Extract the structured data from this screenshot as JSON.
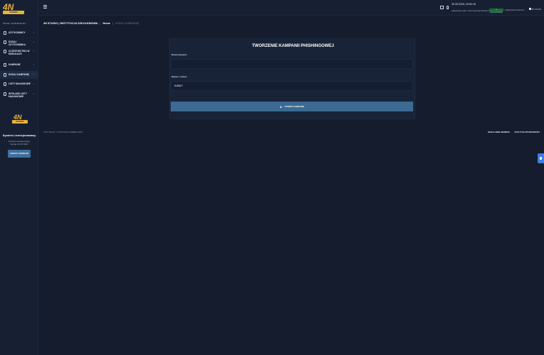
{
  "app": {
    "logo_mark": "4N",
    "logo_sub": "STUDIO"
  },
  "sidebar": {
    "panel_label": "PANEL KONTROLNY",
    "items": [
      {
        "label": "UŻYTKOWNICY"
      },
      {
        "label": "DODAJ UŻYTKOWNIKA"
      },
      {
        "label": "UCZESTNICTWO W MODUŁACH"
      },
      {
        "label": "KAMPANIE"
      },
      {
        "label": "DODAJ KAMPANIĘ"
      },
      {
        "label": "LISTY MAILINGOWE"
      },
      {
        "label": "WYSŁANE LISTY MAILINGOWE"
      }
    ],
    "license": {
      "title": "System Licencjonowany",
      "subtitle_line1": "Produkt Licencjonowany",
      "subtitle_line2": "Wersja: 4N STUDIO",
      "button": "ZAKUP LICENCJĘ"
    }
  },
  "topbar": {
    "datetime": "30.05.2025, 09:52:15",
    "logged_in": "Zalogowano jako: Test Instytucja Szkoleniowa",
    "status_badge": "● ZALOGOWANO",
    "email": "info@phisherinstitute.pl",
    "ip": "IP: 0.0.0.0"
  },
  "breadcrumb": {
    "org": "4N STUDIO | INSTYTUCJA SZKOLENIOWA",
    "home": "Home",
    "current": "DODAJ KAMPANIĘ"
  },
  "form": {
    "title": "TWORZENIE KAMPANII PHISHINGOWEJ",
    "name_label": "Nazwa kampanii",
    "name_value": "",
    "template_label": "Wybierz szablon",
    "template_value": "SUBMIT",
    "submit": "UTWÓRZ KAMPANIĘ"
  },
  "footer": {
    "copyright": "COPYRIGHT © 4N STUDIO SOBIERA 2025",
    "link1": "REGULAMIN SERWISU",
    "link2": "POLITYKA PRYWATNOŚCI"
  }
}
